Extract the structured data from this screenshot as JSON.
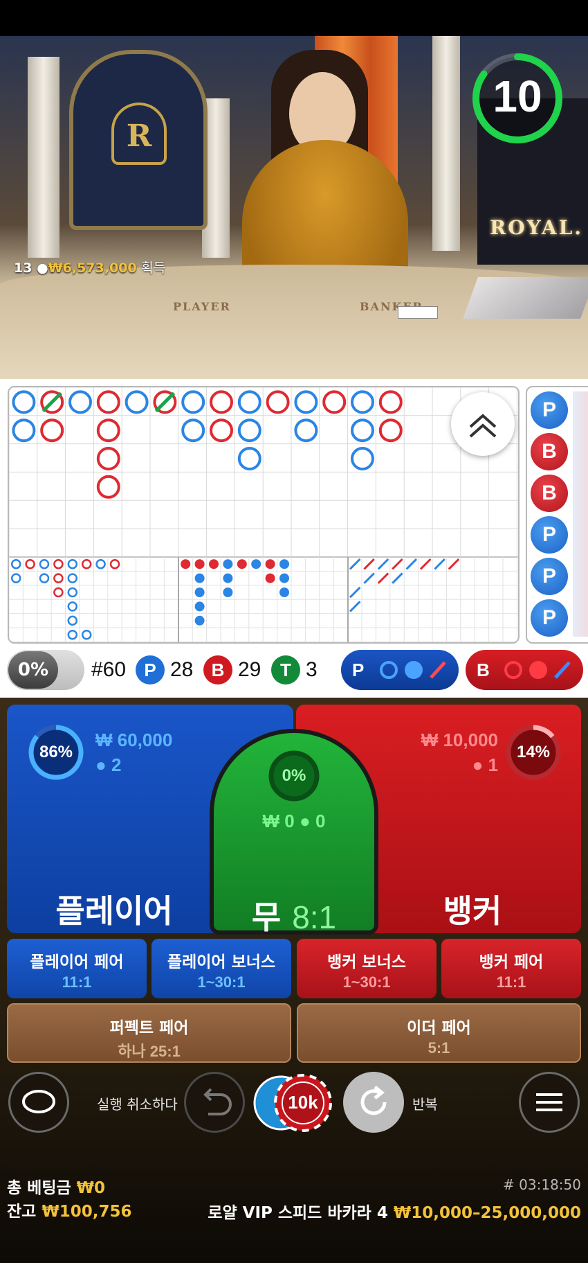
{
  "video": {
    "timer": "10",
    "timer_fraction": 0.85,
    "winners_count": "13",
    "winnings_amount": "₩6,573,000",
    "winnings_label": "획득",
    "felt_player": "PLAYER",
    "felt_banker": "BANKER",
    "sign_text": "ROYAL."
  },
  "roadmap": {
    "stats_percent": "0%",
    "round_number": "#60",
    "player_badge": "P",
    "player_count": "28",
    "banker_badge": "B",
    "banker_count": "29",
    "tie_badge": "T",
    "tie_count": "3",
    "predict_player": "P",
    "predict_banker": "B",
    "bead_road": [
      "P",
      "B",
      "B",
      "P",
      "P",
      "P"
    ]
  },
  "bets": {
    "player": {
      "label": "플레이어",
      "amount": "₩ 60,000",
      "users": "2",
      "percent": "86%"
    },
    "tie": {
      "label": "무",
      "payout": "8:1",
      "amount": "₩ 0",
      "users": "0",
      "percent": "0%"
    },
    "banker": {
      "label": "뱅커",
      "amount": "₩ 10,000",
      "users": "1",
      "percent": "14%"
    },
    "side": [
      {
        "label": "플레이어 페어",
        "payout": "11:1"
      },
      {
        "label": "플레이어 보너스",
        "payout": "1~30:1"
      },
      {
        "label": "뱅커 보너스",
        "payout": "1~30:1"
      },
      {
        "label": "뱅커 페어",
        "payout": "11:1"
      }
    ],
    "perfect_pair": {
      "label": "퍼펙트 페어",
      "payout": "하나 25:1"
    },
    "either_pair": {
      "label": "이더 페어",
      "payout": "5:1"
    }
  },
  "controls": {
    "undo_label": "실행 취소하다",
    "chip_value": "10k",
    "repeat_label": "반복"
  },
  "footer": {
    "total_bet_label": "총 베팅금",
    "total_bet_value": "₩0",
    "balance_label": "잔고",
    "balance_value": "₩100,756",
    "round_id": "# 03:18:50",
    "table_name": "로얄 VIP 스피드 바카라 4",
    "limits": "₩10,000–25,000,000"
  },
  "colors": {
    "player_blue": "#1a56c9",
    "banker_red": "#d91e22",
    "tie_green": "#22b43a",
    "accent_gold": "#f3c23a"
  }
}
